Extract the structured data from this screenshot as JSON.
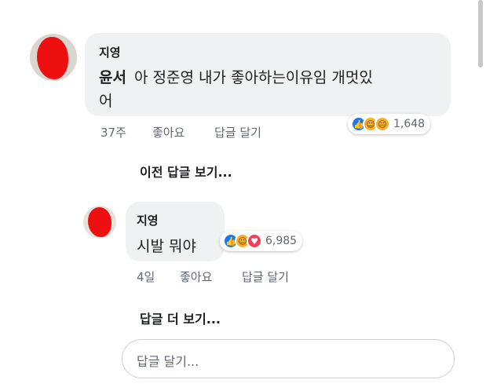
{
  "comment": {
    "author": "지영",
    "mention": "윤서",
    "text_line1": "아 정준영 내가 좋아하는이유임 개멋있",
    "text_line2": "어",
    "time": "37주",
    "like_label": "좋아요",
    "reply_label": "답글 달기",
    "reactions": [
      "like-icon",
      "haha-icon",
      "sad-icon"
    ],
    "reaction_count": "1,648"
  },
  "previous_replies_label": "이전 답글 보기...",
  "reply": {
    "author": "지영",
    "text": "시발 뭐야",
    "time": "4일",
    "like_label": "좋아요",
    "reply_label": "답글 달기",
    "reactions": [
      "like-icon",
      "haha-icon",
      "love-icon"
    ],
    "reaction_count": "6,985"
  },
  "more_replies_label": "답글 더 보기...",
  "reply_input": {
    "placeholder": "답글 달기..."
  },
  "colors": {
    "like_blue": "#1877f2",
    "haha_yellow": "#f7b125",
    "love_red": "#f33e58",
    "bubble_gray": "#f0f1f3"
  }
}
